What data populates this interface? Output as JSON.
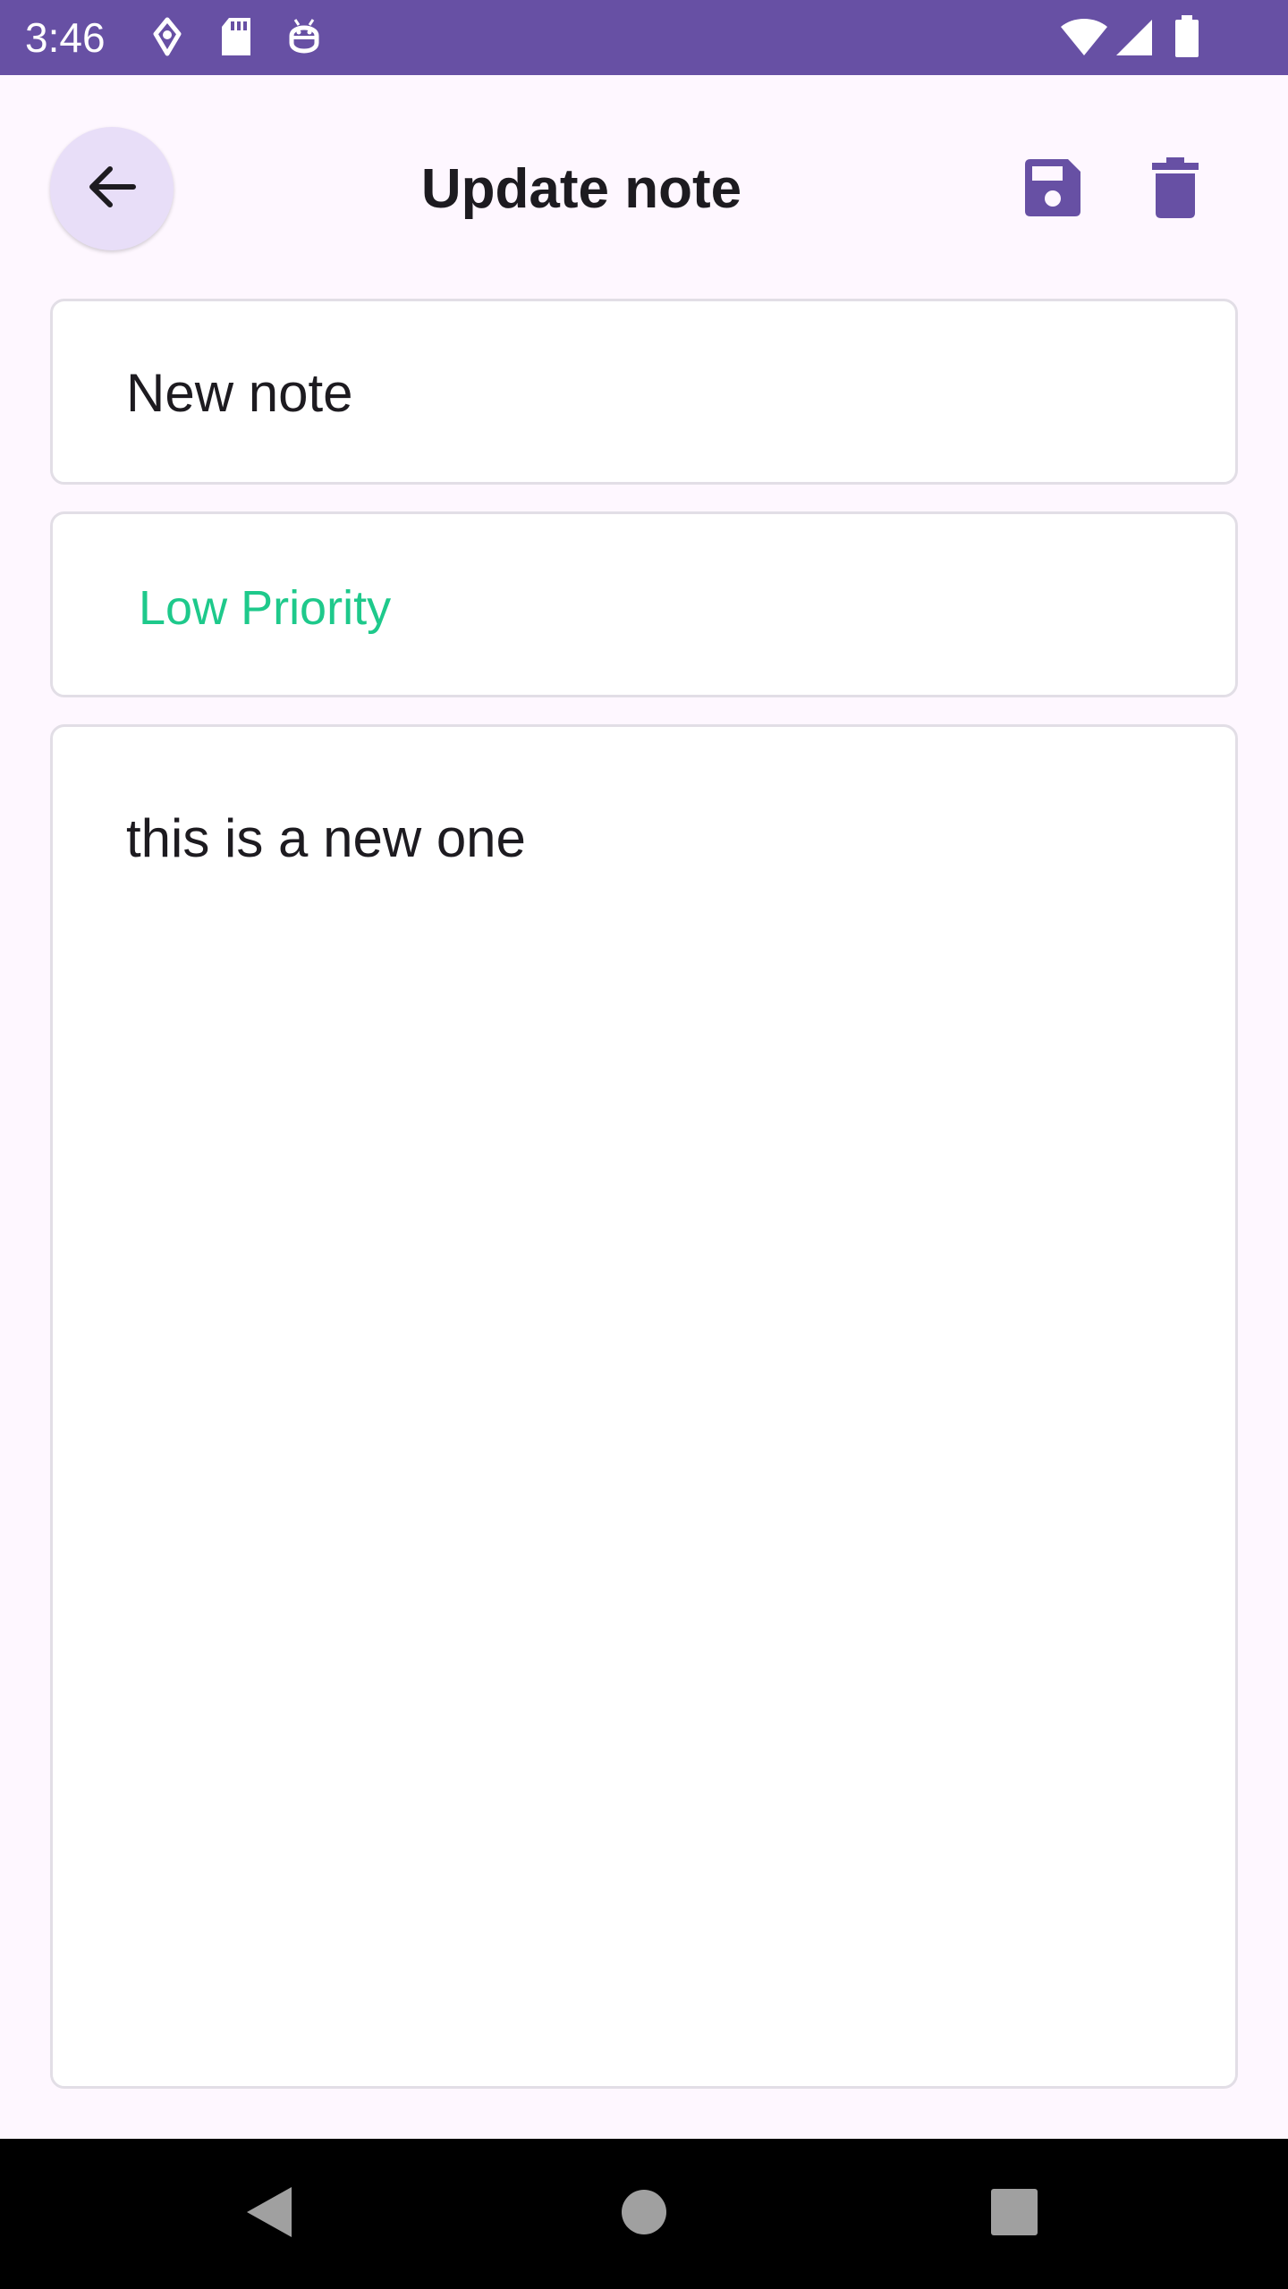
{
  "status_bar": {
    "time": "3:46",
    "left_icons": [
      "navigation-icon",
      "sd-card-icon",
      "android-debug-icon"
    ],
    "right_icons": [
      "wifi-icon",
      "signal-icon",
      "battery-icon"
    ]
  },
  "app_bar": {
    "back_icon": "arrow-back-icon",
    "title": "Update note",
    "save_icon": "save-icon",
    "delete_icon": "delete-icon"
  },
  "form": {
    "title_value": "New note",
    "priority_value": "Low Priority",
    "body_value": "this is a new one"
  },
  "colors": {
    "accent": "#6750a4",
    "priority_low": "#1ec98b",
    "back_button_bg": "#e8def8",
    "background": "#fef7ff"
  },
  "nav_bar": {
    "icons": [
      "back-triangle-icon",
      "home-circle-icon",
      "recents-square-icon"
    ]
  }
}
